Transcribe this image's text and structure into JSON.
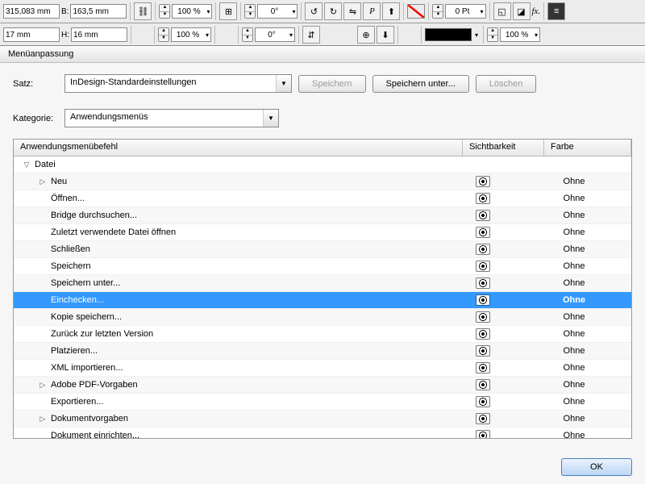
{
  "toolbar": {
    "x": "315,083 mm",
    "y": "17 mm",
    "w": "163,5 mm",
    "h": "16 mm",
    "scaleX": "100 %",
    "scaleY": "100 %",
    "rot": "0°",
    "shearX": "0°",
    "shearY": "0°",
    "stroke": "0 Pt",
    "opacity": "100 %",
    "fx": "fx."
  },
  "dialog": {
    "title": "Menüanpassung",
    "satz_label": "Satz:",
    "satz_value": "InDesign-Standardeinstellungen",
    "save": "Speichern",
    "saveAs": "Speichern unter...",
    "delete": "Löschen",
    "kat_label": "Kategorie:",
    "kat_value": "Anwendungsmenüs",
    "col1": "Anwendungsmenübefehl",
    "col2": "Sichtbarkeit",
    "col3": "Farbe",
    "ok": "OK"
  },
  "rows": [
    {
      "label": "Datei",
      "depth": 0,
      "expand": "open",
      "color": ""
    },
    {
      "label": "Neu",
      "depth": 1,
      "expand": "closed",
      "color": "Ohne"
    },
    {
      "label": "Öffnen...",
      "depth": 1,
      "expand": "",
      "color": "Ohne"
    },
    {
      "label": "Bridge durchsuchen...",
      "depth": 1,
      "expand": "",
      "color": "Ohne"
    },
    {
      "label": "Zuletzt verwendete Datei öffnen",
      "depth": 1,
      "expand": "",
      "color": "Ohne"
    },
    {
      "label": "Schließen",
      "depth": 1,
      "expand": "",
      "color": "Ohne"
    },
    {
      "label": "Speichern",
      "depth": 1,
      "expand": "",
      "color": "Ohne"
    },
    {
      "label": "Speichern unter...",
      "depth": 1,
      "expand": "",
      "color": "Ohne"
    },
    {
      "label": "Einchecken...",
      "depth": 1,
      "expand": "",
      "color": "Ohne",
      "selected": true
    },
    {
      "label": "Kopie speichern...",
      "depth": 1,
      "expand": "",
      "color": "Ohne"
    },
    {
      "label": "Zurück zur letzten Version",
      "depth": 1,
      "expand": "",
      "color": "Ohne"
    },
    {
      "label": "Platzieren...",
      "depth": 1,
      "expand": "",
      "color": "Ohne"
    },
    {
      "label": "XML importieren...",
      "depth": 1,
      "expand": "",
      "color": "Ohne"
    },
    {
      "label": "Adobe PDF-Vorgaben",
      "depth": 1,
      "expand": "closed",
      "color": "Ohne"
    },
    {
      "label": "Exportieren...",
      "depth": 1,
      "expand": "",
      "color": "Ohne"
    },
    {
      "label": "Dokumentvorgaben",
      "depth": 1,
      "expand": "closed",
      "color": "Ohne"
    },
    {
      "label": "Dokument einrichten...",
      "depth": 1,
      "expand": "",
      "color": "Ohne"
    }
  ]
}
